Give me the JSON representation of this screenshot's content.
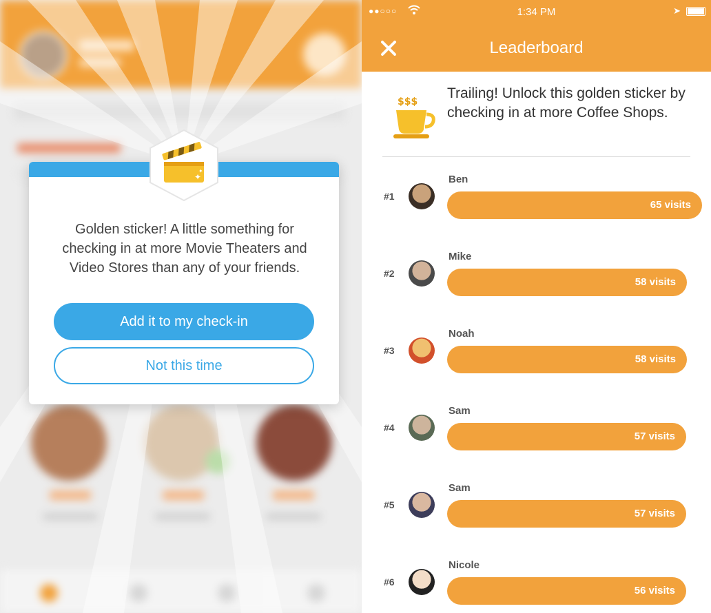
{
  "left_panel": {
    "modal": {
      "message": "Golden sticker! A little something for checking in at more Movie Theaters and Video Stores than any of your friends.",
      "primary_button": "Add it to my check-in",
      "secondary_button": "Not this time"
    },
    "colors": {
      "accent_blue": "#3aa8e6",
      "header_orange": "#f2a23c"
    },
    "sticker_icon": "clapperboard-icon"
  },
  "right_panel": {
    "status_bar": {
      "signal": "●●○○○",
      "time": "1:34 PM"
    },
    "header": {
      "title": "Leaderboard"
    },
    "trailing": {
      "message": "Trailing! Unlock this golden sticker by checking in at more Coffee Shops.",
      "icon": "coffee-cup-icon"
    },
    "leaderboard": [
      {
        "rank": "#1",
        "name": "Ben",
        "visits_label": "65 visits",
        "visits": 65
      },
      {
        "rank": "#2",
        "name": "Mike",
        "visits_label": "58 visits",
        "visits": 58
      },
      {
        "rank": "#3",
        "name": "Noah",
        "visits_label": "58 visits",
        "visits": 58
      },
      {
        "rank": "#4",
        "name": "Sam",
        "visits_label": "57 visits",
        "visits": 57
      },
      {
        "rank": "#5",
        "name": "Sam",
        "visits_label": "57 visits",
        "visits": 57
      },
      {
        "rank": "#6",
        "name": "Nicole",
        "visits_label": "56 visits",
        "visits": 56
      }
    ],
    "colors": {
      "bar": "#f2a23c"
    }
  }
}
